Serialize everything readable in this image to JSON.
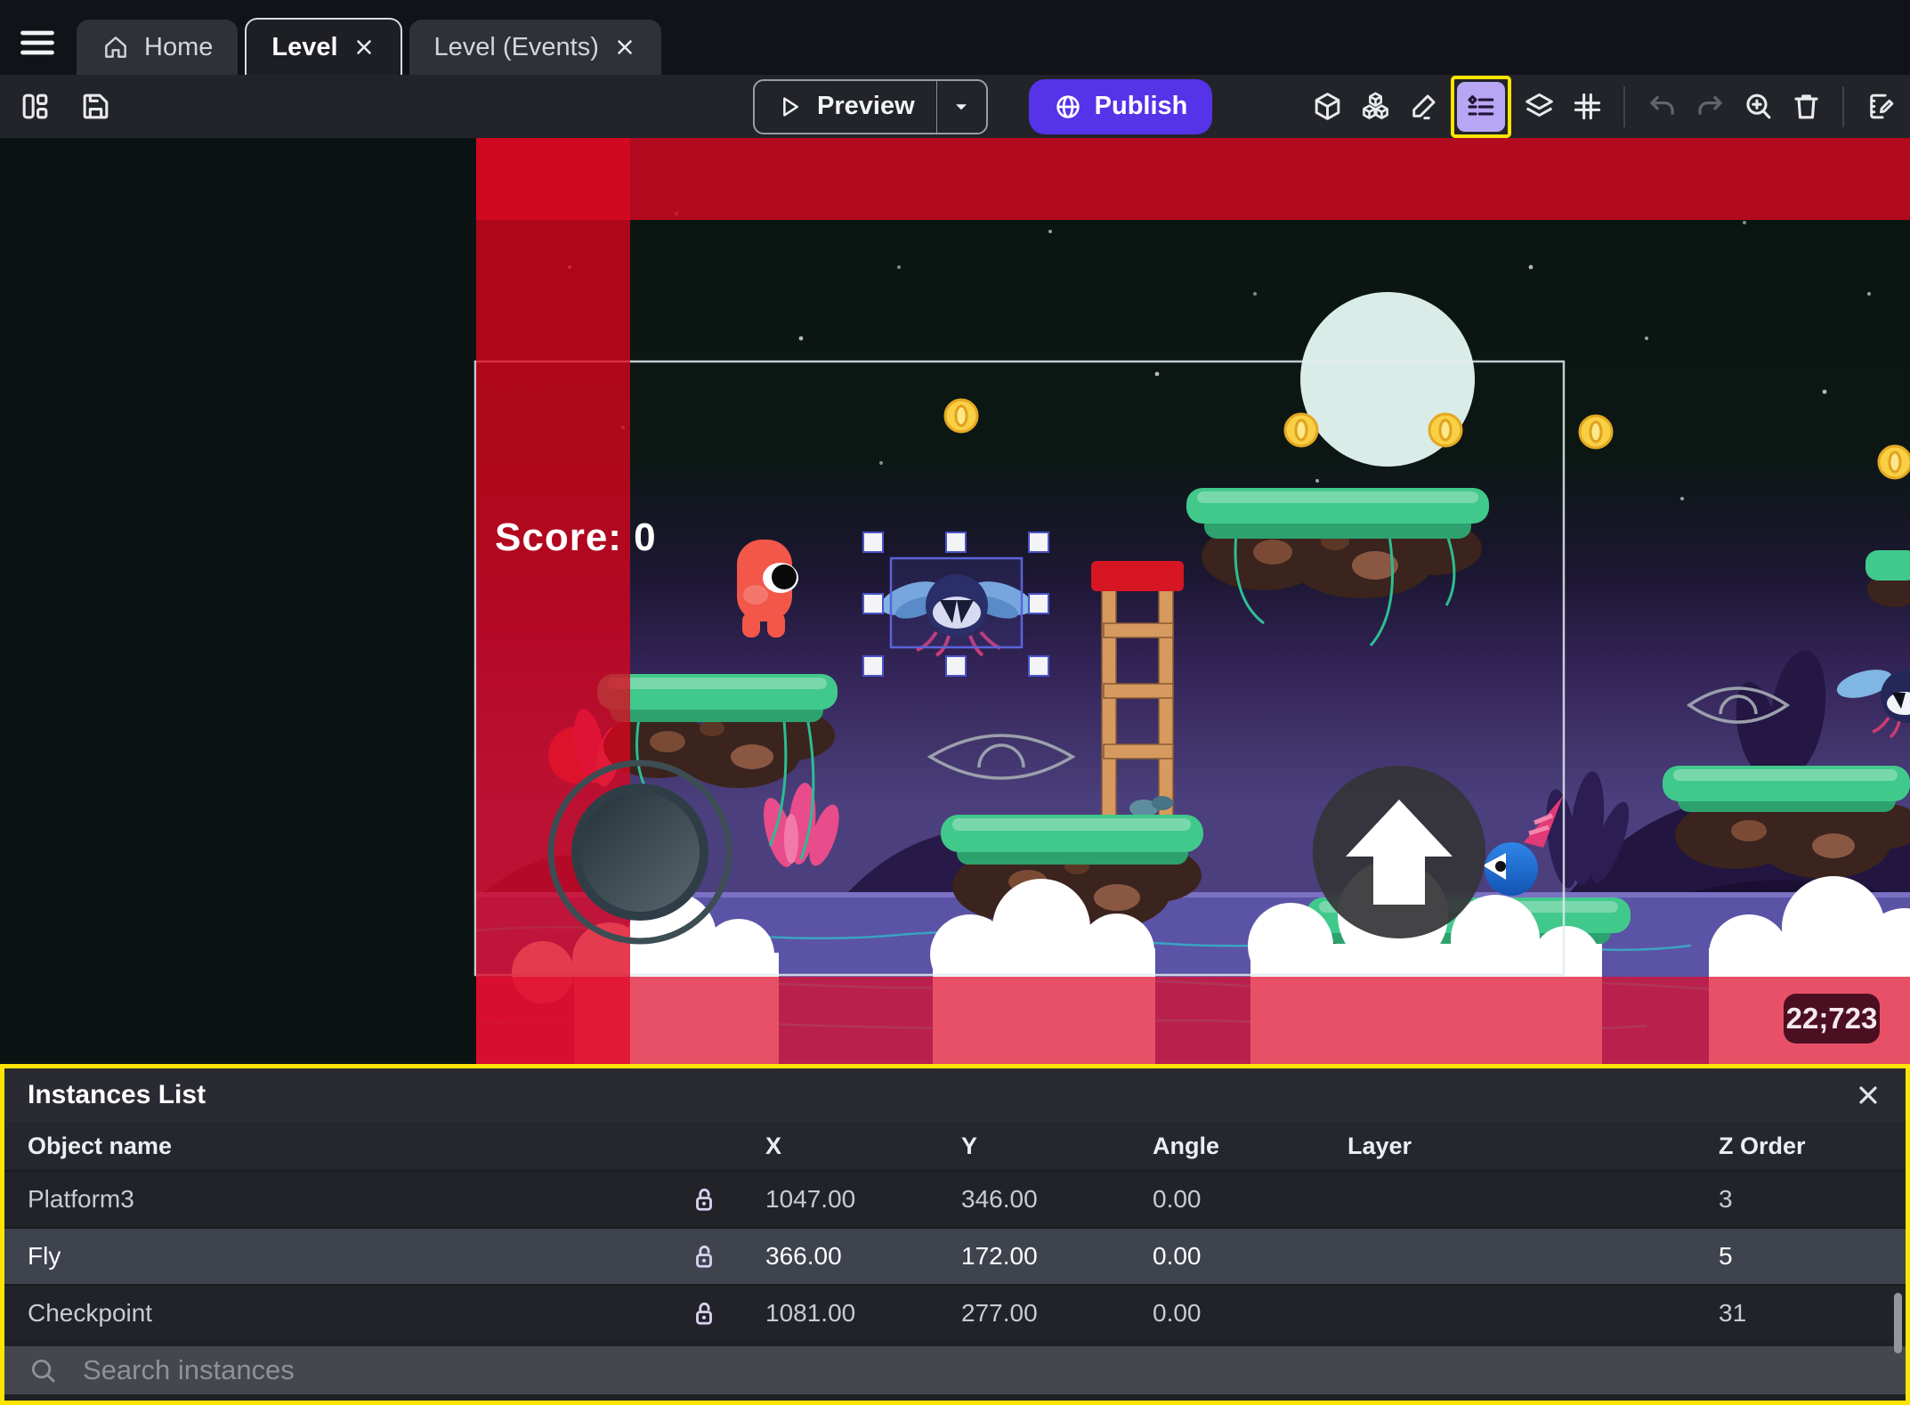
{
  "tab_bar": {
    "tabs": [
      {
        "label": "Home",
        "active": false
      },
      {
        "label": "Level",
        "active": true
      },
      {
        "label": "Level (Events)",
        "active": false
      }
    ]
  },
  "toolbar": {
    "preview_label": "Preview",
    "publish_label": "Publish",
    "right_icons": [
      "box-3d",
      "objects",
      "pencil",
      "instances-list",
      "layers",
      "grid",
      "undo",
      "redo",
      "zoom-in",
      "trash",
      "edit-scene"
    ],
    "active_tool": "instances-list"
  },
  "canvas": {
    "score_text": "Score: 0",
    "coords_badge": "22;723",
    "selected_instance": "Fly"
  },
  "instances_panel": {
    "title": "Instances List",
    "columns": [
      "Object name",
      "X",
      "Y",
      "Angle",
      "Layer",
      "Z Order"
    ],
    "rows": [
      {
        "name": "Platform3",
        "x": "1047.00",
        "y": "346.00",
        "angle": "0.00",
        "layer": "",
        "z_order": "3",
        "selected": false
      },
      {
        "name": "Fly",
        "x": "366.00",
        "y": "172.00",
        "angle": "0.00",
        "layer": "",
        "z_order": "5",
        "selected": true
      },
      {
        "name": "Checkpoint",
        "x": "1081.00",
        "y": "277.00",
        "angle": "0.00",
        "layer": "",
        "z_order": "31",
        "selected": false
      }
    ],
    "search_placeholder": "Search instances"
  },
  "icons": {
    "tab_bar": [
      "menu-icon",
      "home-icon",
      "close-icon"
    ],
    "toolbar_left": [
      "layout-icon",
      "save-icon"
    ],
    "toolbar_center": [
      "play-icon",
      "caret-down-icon",
      "globe-icon"
    ],
    "panel": [
      "close-icon",
      "lock-open-icon",
      "search-icon"
    ]
  },
  "colors": {
    "publish_purple": "#5433e8",
    "highlight_yellow": "#ffe400",
    "tool_highlight_purple": "#b7a6f4",
    "selection_blue": "#5a64d8",
    "guide_red": "#d8041e",
    "selected_row": "#3e434e"
  }
}
